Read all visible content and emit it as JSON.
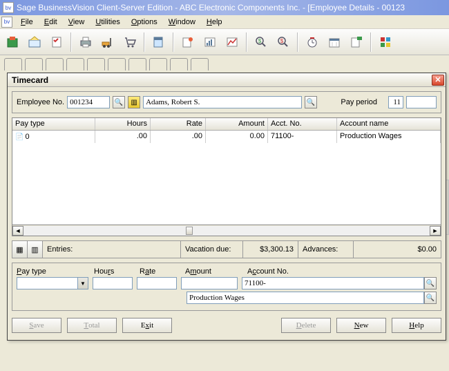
{
  "title": "Sage BusinessVision Client-Server Edition - ABC Electronic Components Inc. - [Employee Details - 00123",
  "menu": [
    "File",
    "Edit",
    "View",
    "Utilities",
    "Options",
    "Window",
    "Help"
  ],
  "dialog": {
    "title": "Timecard",
    "employee_no_label": "Employee No.",
    "employee_no": "001234",
    "employee_name": "Adams, Robert S.",
    "pay_period_label": "Pay period",
    "pay_period": "11",
    "grid_headers": {
      "paytype": "Pay type",
      "hours": "Hours",
      "rate": "Rate",
      "amount": "Amount",
      "acct": "Acct. No.",
      "acctname": "Account name"
    },
    "grid_row": {
      "paytype": "0",
      "hours": ".00",
      "rate": ".00",
      "amount": "0.00",
      "acct": "71100-",
      "acctname": "Production Wages"
    },
    "summary": {
      "entries_label": "Entries:",
      "vac_label": "Vacation due:",
      "vac_value": "$3,300.13",
      "adv_label": "Advances:",
      "adv_value": "$0.00"
    },
    "entry": {
      "head": {
        "paytype": "Pay type",
        "hours": "Hours",
        "rate": "Rate",
        "amount": "Amount",
        "acctno": "Account No."
      },
      "acctno": "71100-",
      "acctname": "Production Wages"
    },
    "buttons": {
      "save": "Save",
      "total": "Total",
      "exit": "Exit",
      "delete": "Delete",
      "new": "New",
      "help": "Help"
    }
  }
}
